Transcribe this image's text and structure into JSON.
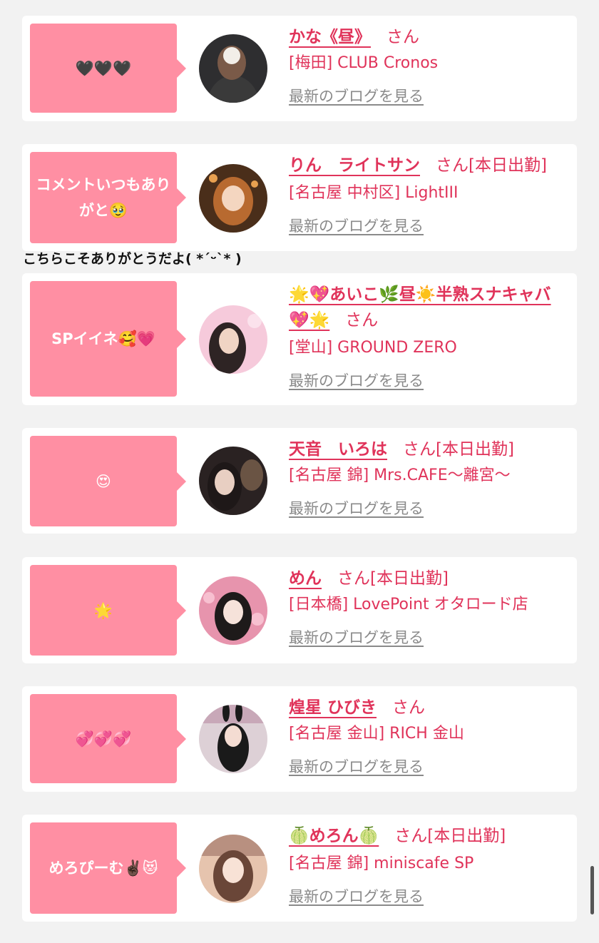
{
  "blog_label": "最新のブログを見る",
  "san": "さん",
  "reply_text": "こちらこそありがとうだよ( *ˊᵕˋ* )",
  "cards": [
    {
      "comment": "🖤🖤🖤",
      "name": "かな《昼》",
      "status": "",
      "shop": "[梅田] CLUB Cronos",
      "avatar_colors": [
        "#3a3a3a",
        "#8a7060"
      ]
    },
    {
      "comment": "コメントいつもありがと🥹",
      "name": "りん　ライトサン",
      "status": "[本日出勤]",
      "shop": "[名古屋 中村区] LightIII",
      "avatar_colors": [
        "#5a3a20",
        "#c8864a"
      ]
    },
    {
      "comment": "SPイイネ🥰💗",
      "name": "🌟💖あいこ🌿昼☀️半熟スナキャバ💖🌟",
      "status": "",
      "shop": "[堂山] GROUND ZERO",
      "avatar_colors": [
        "#f5c6d6",
        "#3a2a2a"
      ]
    },
    {
      "comment": "😍",
      "name": "天音　いろは",
      "status": "[本日出勤]",
      "shop": "[名古屋 錦] Mrs.CAFE～離宮～",
      "avatar_colors": [
        "#2a2020",
        "#8a6a50"
      ]
    },
    {
      "comment": "🌟",
      "name": "めん",
      "status": "[本日出勤]",
      "shop": "[日本橋] LovePoint オタロード店",
      "avatar_colors": [
        "#e89ab0",
        "#2a2020"
      ]
    },
    {
      "comment": "💞💞💞",
      "name": "煌星 ひびき",
      "status": "",
      "shop": "[名古屋 金山] RICH 金山",
      "avatar_colors": [
        "#d8c8d0",
        "#1a1a1a"
      ]
    },
    {
      "comment": "めろぴーむ✌🏿😻",
      "name": "🍈めろん🍈",
      "status": "[本日出勤]",
      "shop": "[名古屋 錦] miniscafe SP",
      "avatar_colors": [
        "#e8c8b0",
        "#6a4a3a"
      ]
    }
  ]
}
